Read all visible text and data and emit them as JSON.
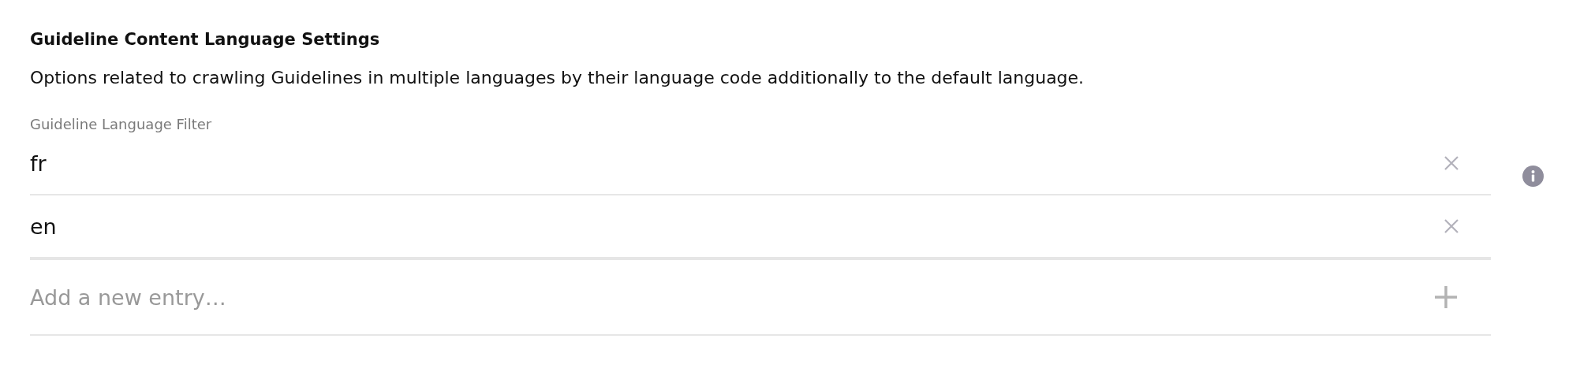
{
  "section": {
    "title": "Guideline Content Language Settings",
    "description": "Options related to crawling Guidelines in multiple languages by their language code additionally to the default language."
  },
  "filter": {
    "label": "Guideline Language Filter",
    "entries": [
      {
        "value": "fr"
      },
      {
        "value": "en"
      }
    ],
    "new_entry": {
      "placeholder": "Add a new entry…"
    }
  }
}
